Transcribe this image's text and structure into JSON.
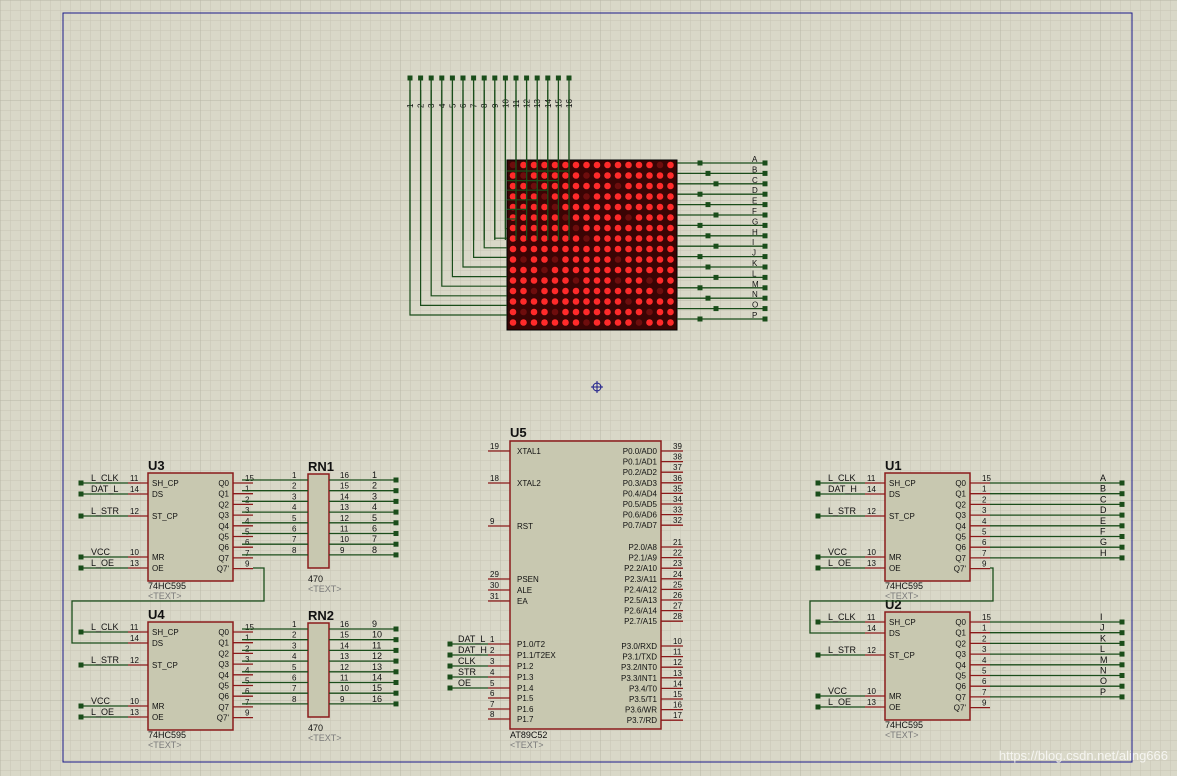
{
  "matrix": {
    "cols": [
      "1",
      "2",
      "3",
      "4",
      "5",
      "6",
      "7",
      "8",
      "9",
      "10",
      "11",
      "12",
      "13",
      "14",
      "15",
      "16"
    ],
    "rows": [
      "A",
      "B",
      "C",
      "D",
      "E",
      "F",
      "G",
      "H",
      "I",
      "J",
      "K",
      "L",
      "M",
      "N",
      "O",
      "P"
    ]
  },
  "u5": {
    "ref": "U5",
    "part": "AT89C52",
    "text": "<TEXT>",
    "left_pins": [
      {
        "n": "19",
        "name": "XTAL1"
      },
      {
        "n": "18",
        "name": "XTAL2"
      },
      {
        "n": "9",
        "name": "RST"
      },
      {
        "n": "29",
        "name": "PSEN"
      },
      {
        "n": "30",
        "name": "ALE"
      },
      {
        "n": "31",
        "name": "EA"
      },
      {
        "n": "1",
        "name": "P1.0/T2"
      },
      {
        "n": "2",
        "name": "P1.1/T2EX"
      },
      {
        "n": "3",
        "name": "P1.2"
      },
      {
        "n": "4",
        "name": "P1.3"
      },
      {
        "n": "5",
        "name": "P1.4"
      },
      {
        "n": "6",
        "name": "P1.5"
      },
      {
        "n": "7",
        "name": "P1.6"
      },
      {
        "n": "8",
        "name": "P1.7"
      }
    ],
    "right_pins": [
      {
        "n": "39",
        "name": "P0.0/AD0"
      },
      {
        "n": "38",
        "name": "P0.1/AD1"
      },
      {
        "n": "37",
        "name": "P0.2/AD2"
      },
      {
        "n": "36",
        "name": "P0.3/AD3"
      },
      {
        "n": "35",
        "name": "P0.4/AD4"
      },
      {
        "n": "34",
        "name": "P0.5/AD5"
      },
      {
        "n": "33",
        "name": "P0.6/AD6"
      },
      {
        "n": "32",
        "name": "P0.7/AD7"
      },
      {
        "n": "21",
        "name": "P2.0/A8"
      },
      {
        "n": "22",
        "name": "P2.1/A9"
      },
      {
        "n": "23",
        "name": "P2.2/A10"
      },
      {
        "n": "24",
        "name": "P2.3/A11"
      },
      {
        "n": "25",
        "name": "P2.4/A12"
      },
      {
        "n": "26",
        "name": "P2.5/A13"
      },
      {
        "n": "27",
        "name": "P2.6/A14"
      },
      {
        "n": "28",
        "name": "P2.7/A15"
      },
      {
        "n": "10",
        "name": "P3.0/RXD"
      },
      {
        "n": "11",
        "name": "P3.1/TXD"
      },
      {
        "n": "12",
        "name": "P3.2/INT0"
      },
      {
        "n": "13",
        "name": "P3.3/INT1"
      },
      {
        "n": "14",
        "name": "P3.4/T0"
      },
      {
        "n": "15",
        "name": "P3.5/T1"
      },
      {
        "n": "16",
        "name": "P3.6/WR"
      },
      {
        "n": "17",
        "name": "P3.7/RD"
      }
    ],
    "net_labels": [
      "DAT_L",
      "DAT_H",
      "CLK",
      "STR",
      "OE"
    ]
  },
  "shift_registers": [
    {
      "ref": "U3",
      "part": "74HC595",
      "text": "<TEXT>",
      "inputs": [
        "L_CLK",
        "DAT_L",
        "L_STR",
        "VCC",
        "L_OE"
      ],
      "outputs": []
    },
    {
      "ref": "U4",
      "part": "74HC595",
      "text": "<TEXT>",
      "inputs": [
        "L_CLK",
        "L_STR",
        "VCC",
        "L_OE"
      ],
      "outputs": []
    },
    {
      "ref": "U1",
      "part": "74HC595",
      "text": "<TEXT>",
      "inputs": [
        "L_CLK",
        "DAT_H",
        "L_STR",
        "VCC",
        "L_OE"
      ],
      "outputs": [
        "A",
        "B",
        "C",
        "D",
        "E",
        "F",
        "G",
        "H"
      ]
    },
    {
      "ref": "U2",
      "part": "74HC595",
      "text": "<TEXT>",
      "inputs": [
        "L_CLK",
        "L_STR",
        "VCC",
        "L_OE"
      ],
      "outputs": [
        "I",
        "J",
        "K",
        "L",
        "M",
        "N",
        "O",
        "P"
      ]
    }
  ],
  "chip_pins": {
    "left": [
      {
        "n": "11",
        "name": "SH_CP"
      },
      {
        "n": "14",
        "name": "DS"
      },
      {
        "n": "12",
        "name": "ST_CP"
      },
      {
        "n": "10",
        "name": "MR"
      },
      {
        "n": "13",
        "name": "OE"
      }
    ],
    "right": [
      {
        "n": "15",
        "name": "Q0"
      },
      {
        "n": "1",
        "name": "Q1"
      },
      {
        "n": "2",
        "name": "Q2"
      },
      {
        "n": "3",
        "name": "Q3"
      },
      {
        "n": "4",
        "name": "Q4"
      },
      {
        "n": "5",
        "name": "Q5"
      },
      {
        "n": "6",
        "name": "Q6"
      },
      {
        "n": "7",
        "name": "Q7"
      },
      {
        "n": "9",
        "name": "Q7'"
      }
    ]
  },
  "resistor_networks": [
    {
      "ref": "RN1",
      "value": "470",
      "text": "<TEXT>",
      "left": [
        "1",
        "2",
        "3",
        "4",
        "5",
        "6",
        "7",
        "8"
      ],
      "right": [
        "16",
        "15",
        "14",
        "13",
        "12",
        "11",
        "10",
        "9"
      ],
      "outputs": [
        "1",
        "2",
        "3",
        "4",
        "5",
        "6",
        "7",
        "8"
      ]
    },
    {
      "ref": "RN2",
      "value": "470",
      "text": "<TEXT>",
      "left": [
        "1",
        "2",
        "3",
        "4",
        "5",
        "6",
        "7",
        "8"
      ],
      "right": [
        "16",
        "15",
        "14",
        "13",
        "12",
        "11",
        "10",
        "9"
      ],
      "outputs": [
        "9",
        "10",
        "11",
        "12",
        "13",
        "14",
        "15",
        "16"
      ]
    }
  ],
  "watermark": "https://blog.csdn.net/aling666",
  "colors": {
    "background": "#d9d8c8",
    "grid": "#c4c3b3",
    "component": "#c8c8b0",
    "outline": "#8b1a1a",
    "wire": "#1a4d1a",
    "frame": "#1a1a8a",
    "led_on": "#ff2a2a",
    "led_off": "#6e0d0d"
  }
}
